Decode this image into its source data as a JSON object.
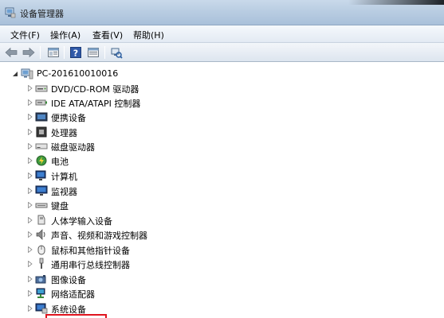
{
  "window": {
    "title": "设备管理器"
  },
  "menu": [
    {
      "label": "文件(F)"
    },
    {
      "label": "操作(A)"
    },
    {
      "label": "查看(V)"
    },
    {
      "label": "帮助(H)"
    }
  ],
  "toolbar": {
    "buttons": [
      {
        "icon": "back-arrow-icon"
      },
      {
        "icon": "forward-arrow-icon"
      },
      {
        "icon": "properties-icon"
      },
      {
        "icon": "help-icon"
      },
      {
        "icon": "device-view-icon"
      },
      {
        "icon": "scan-hardware-icon"
      }
    ]
  },
  "tree": {
    "root": {
      "label": "PC-201610010016",
      "icon": "computer-icon"
    },
    "items": [
      {
        "label": "DVD/CD-ROM 驱动器",
        "icon": "dvd-drive-icon"
      },
      {
        "label": "IDE ATA/ATAPI 控制器",
        "icon": "ide-controller-icon"
      },
      {
        "label": "便携设备",
        "icon": "portable-device-icon"
      },
      {
        "label": "处理器",
        "icon": "processor-icon"
      },
      {
        "label": "磁盘驱动器",
        "icon": "disk-drive-icon"
      },
      {
        "label": "电池",
        "icon": "battery-icon"
      },
      {
        "label": "计算机",
        "icon": "computer-icon"
      },
      {
        "label": "监视器",
        "icon": "monitor-icon"
      },
      {
        "label": "键盘",
        "icon": "keyboard-icon"
      },
      {
        "label": "人体学输入设备",
        "icon": "hid-icon"
      },
      {
        "label": "声音、视频和游戏控制器",
        "icon": "sound-icon"
      },
      {
        "label": "鼠标和其他指针设备",
        "icon": "mouse-icon"
      },
      {
        "label": "通用串行总线控制器",
        "icon": "usb-icon"
      },
      {
        "label": "图像设备",
        "icon": "imaging-device-icon"
      },
      {
        "label": "网络适配器",
        "icon": "network-adapter-icon"
      },
      {
        "label": "系统设备",
        "icon": "system-device-icon"
      }
    ]
  },
  "colors": {
    "highlight_box": "#e0141e"
  }
}
